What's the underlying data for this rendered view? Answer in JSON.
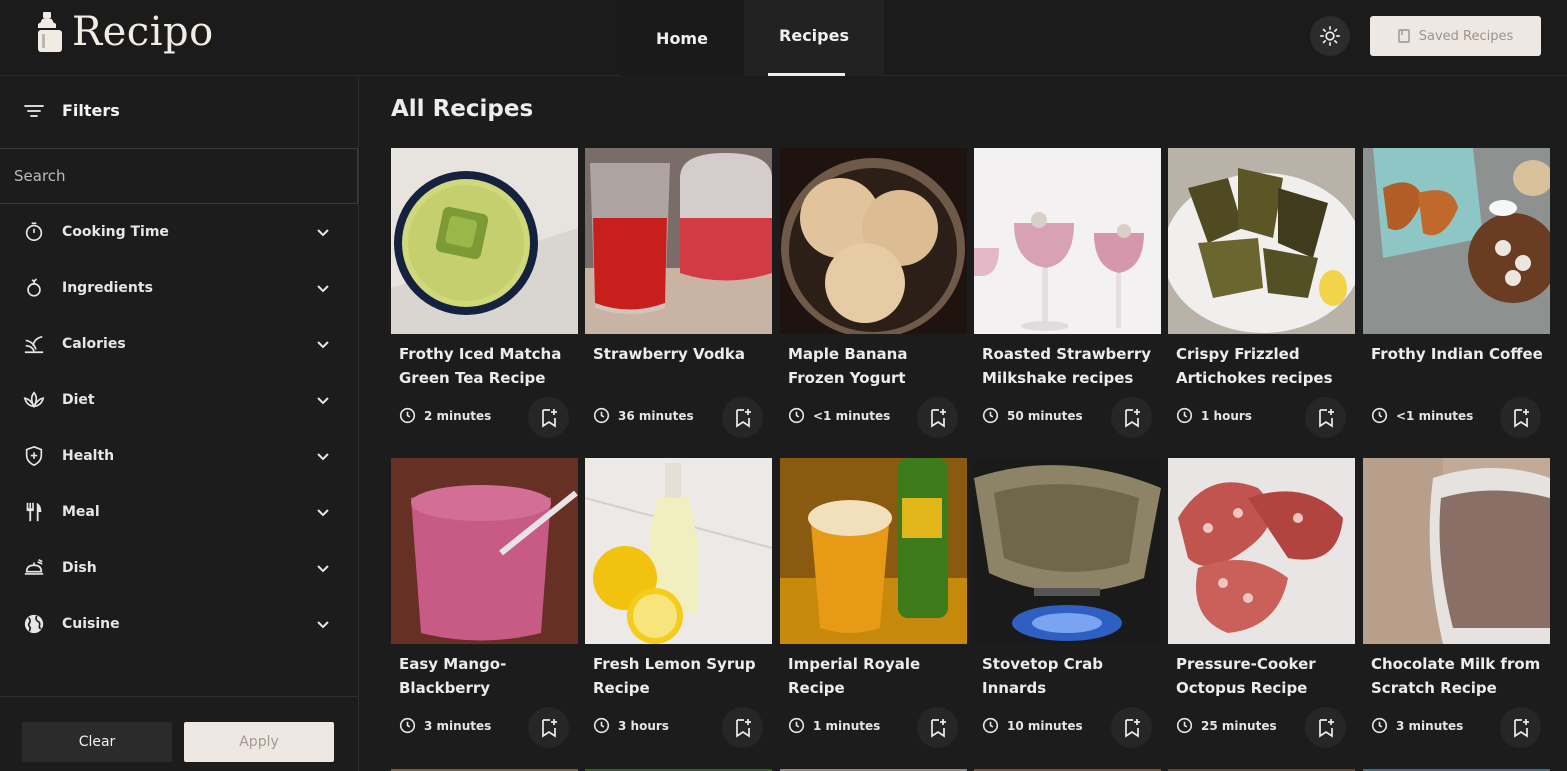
{
  "header": {
    "logo_text": "Recipo",
    "nav": {
      "home": "Home",
      "recipes": "Recipes"
    },
    "saved_button": "Saved Recipes"
  },
  "sidebar": {
    "filters_label": "Filters",
    "search_placeholder": "Search",
    "filters": [
      {
        "label": "Cooking Time",
        "icon": "stopwatch-icon"
      },
      {
        "label": "Ingredients",
        "icon": "ingredient-icon"
      },
      {
        "label": "Calories",
        "icon": "leaf-icon"
      },
      {
        "label": "Diet",
        "icon": "lotus-icon"
      },
      {
        "label": "Health",
        "icon": "shield-plus-icon"
      },
      {
        "label": "Meal",
        "icon": "fork-knife-icon"
      },
      {
        "label": "Dish",
        "icon": "serving-dish-icon"
      },
      {
        "label": "Cuisine",
        "icon": "globe-icon"
      }
    ],
    "clear_label": "Clear",
    "apply_label": "Apply"
  },
  "main": {
    "title": "All Recipes",
    "recipes": [
      {
        "title": "Frothy Iced Matcha Green Tea Recipe",
        "time": "2 minutes",
        "image": "matcha-latte"
      },
      {
        "title": "Strawberry Vodka",
        "time": "36 minutes",
        "image": "strawberry-vodka"
      },
      {
        "title": "Maple Banana Frozen Yogurt",
        "time": "<1 minutes",
        "image": "frozen-yogurt"
      },
      {
        "title": "Roasted Strawberry Milkshake recipes",
        "time": "50 minutes",
        "image": "milkshake"
      },
      {
        "title": "Crispy Frizzled Artichokes recipes",
        "time": "1 hours",
        "image": "artichokes"
      },
      {
        "title": "Frothy Indian Coffee",
        "time": "<1 minutes",
        "image": "croissants-coffee"
      },
      {
        "title": "Easy Mango-Blackberry Smoothie…",
        "time": "3 minutes",
        "image": "smoothie"
      },
      {
        "title": "Fresh Lemon Syrup Recipe",
        "time": "3 hours",
        "image": "lemon-syrup"
      },
      {
        "title": "Imperial Royale Recipe",
        "time": "1 minutes",
        "image": "beer"
      },
      {
        "title": "Stovetop Crab Innards",
        "time": "10 minutes",
        "image": "crab"
      },
      {
        "title": "Pressure-Cooker Octopus Recipe",
        "time": "25 minutes",
        "image": "octopus"
      },
      {
        "title": "Chocolate Milk from Scratch Recipe",
        "time": "3 minutes",
        "image": "chocolate-milk"
      }
    ]
  },
  "colors": {
    "background": "#1c1c1c",
    "accent_button": "#efe7e1",
    "text": "#ececec"
  }
}
